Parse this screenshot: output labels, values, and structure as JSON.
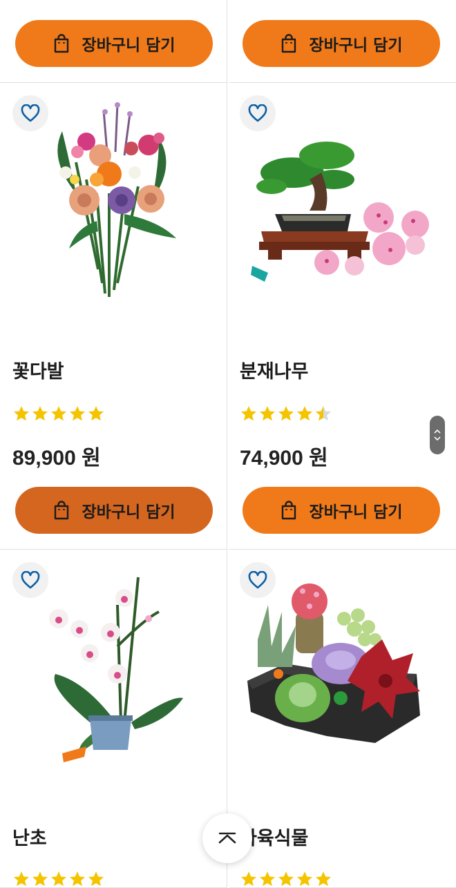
{
  "cart_label": "장바구니 담기",
  "products": [
    {
      "name": "꽃다발",
      "rating": 5,
      "price": "89,900 원"
    },
    {
      "name": "분재나무",
      "rating": 4.5,
      "price": "74,900 원"
    },
    {
      "name": "난초",
      "rating": 5
    },
    {
      "name": "다육식물",
      "rating": 5
    }
  ],
  "colors": {
    "accent": "#f07a1a",
    "accent_pressed": "#d5661f",
    "star": "#f5c400",
    "heart": "#0a5fa6"
  },
  "icons": {
    "bag": "shopping-bag-icon",
    "heart": "heart-icon",
    "back_to_top": "chevron-up-icon"
  }
}
